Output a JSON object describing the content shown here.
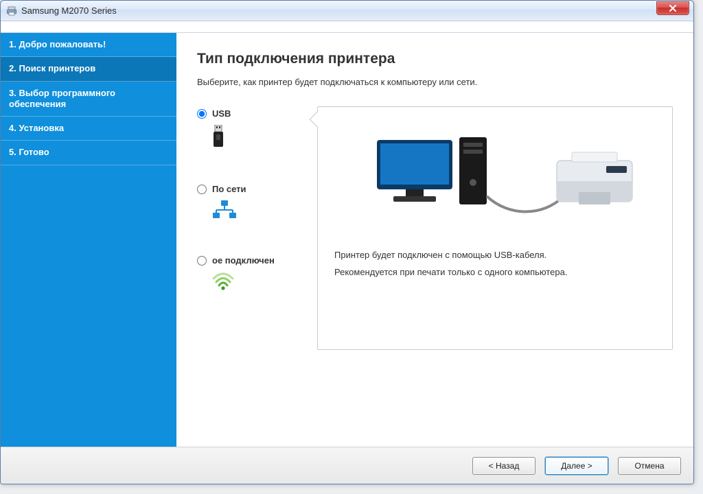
{
  "window": {
    "title": "Samsung M2070 Series"
  },
  "sidebar": {
    "steps": [
      "1. Добро пожаловать!",
      "2. Поиск принтеров",
      "3. Выбор программного обеспечения",
      "4. Установка",
      "5. Готово"
    ],
    "active_index": 1
  },
  "main": {
    "heading": "Тип подключения принтера",
    "subheading": "Выберите, как принтер будет подключаться к компьютеру или сети.",
    "options": [
      {
        "id": "usb",
        "label": "USB",
        "checked": true,
        "icon": "usb-icon"
      },
      {
        "id": "network",
        "label": "По сети",
        "checked": false,
        "icon": "network-icon"
      },
      {
        "id": "wireless",
        "label": "ое подключен",
        "checked": false,
        "icon": "wifi-icon"
      }
    ],
    "preview": {
      "line1": "Принтер будет подключен с помощью USB-кабеля.",
      "line2": "Рекомендуется при печати только с одного компьютера."
    }
  },
  "footer": {
    "back": "< Назад",
    "next": "Далее >",
    "cancel": "Отмена"
  }
}
